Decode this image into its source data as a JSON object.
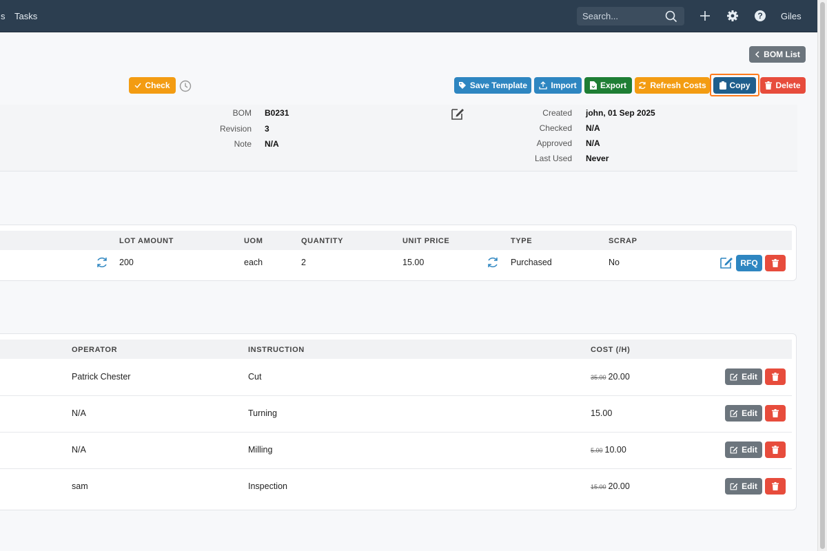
{
  "topbar": {
    "nav_s": "s",
    "nav_tasks": "Tasks",
    "search_placeholder": "Search...",
    "user": "Giles"
  },
  "header": {
    "bom_list_label": "BOM List",
    "check_label": "Check"
  },
  "actions": {
    "save_template": "Save Template",
    "import": "Import",
    "export": "Export",
    "refresh_costs": "Refresh Costs",
    "copy": "Copy",
    "delete": "Delete"
  },
  "info": {
    "bom_label": "BOM",
    "bom_value": "B0231",
    "revision_label": "Revision",
    "revision_value": "3",
    "note_label": "Note",
    "note_value": "N/A",
    "created_label": "Created",
    "created_value": "john, 01 Sep 2025",
    "checked_label": "Checked",
    "checked_value": "N/A",
    "approved_label": "Approved",
    "approved_value": "N/A",
    "last_used_label": "Last Used",
    "last_used_value": "Never"
  },
  "materials": {
    "headers": [
      "LOT AMOUNT",
      "UOM",
      "QUANTITY",
      "UNIT PRICE",
      "TYPE",
      "SCRAP"
    ],
    "row": {
      "lot_amount": "200",
      "uom": "each",
      "quantity": "2",
      "unit_price": "15.00",
      "type": "Purchased",
      "scrap": "No",
      "rfq_label": "RFQ"
    }
  },
  "operations": {
    "headers": [
      "OPERATOR",
      "INSTRUCTION",
      "COST (/H)"
    ],
    "edit_label": "Edit",
    "rows": [
      {
        "operator": "Patrick Chester",
        "instruction": "Cut",
        "old_cost": "35.00",
        "cost": "20.00"
      },
      {
        "operator": "N/A",
        "instruction": "Turning",
        "old_cost": "",
        "cost": "15.00"
      },
      {
        "operator": "N/A",
        "instruction": "Milling",
        "old_cost": "5.00",
        "cost": "10.00"
      },
      {
        "operator": "sam",
        "instruction": "Inspection",
        "old_cost": "15.00",
        "cost": "20.00"
      }
    ]
  },
  "colors": {
    "topbar": "#2c3e50",
    "accent_blue": "#2e86c1",
    "danger": "#e74c3c",
    "warning": "#f39c12",
    "success": "#1e7e34",
    "highlight": "#ff7a1a"
  }
}
